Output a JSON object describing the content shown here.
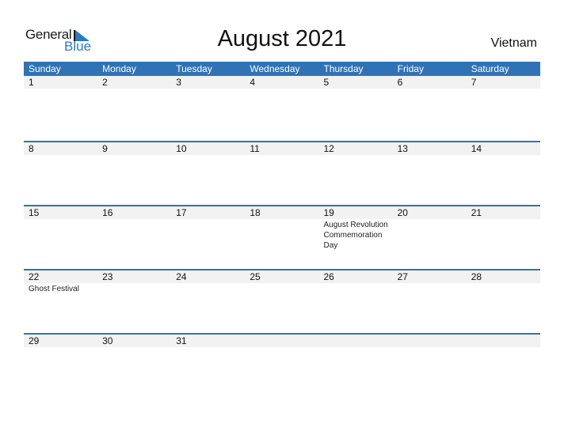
{
  "logo": {
    "general": "General",
    "blue": "Blue"
  },
  "title": "August 2021",
  "country": "Vietnam",
  "colors": {
    "header": "#2f73b5",
    "band": "#f2f2f2",
    "logo_blue": "#2a7ac4"
  },
  "weekdays": [
    "Sunday",
    "Monday",
    "Tuesday",
    "Wednesday",
    "Thursday",
    "Friday",
    "Saturday"
  ],
  "weeks": [
    {
      "days": [
        {
          "n": "1"
        },
        {
          "n": "2"
        },
        {
          "n": "3"
        },
        {
          "n": "4"
        },
        {
          "n": "5"
        },
        {
          "n": "6"
        },
        {
          "n": "7"
        }
      ]
    },
    {
      "days": [
        {
          "n": "8"
        },
        {
          "n": "9"
        },
        {
          "n": "10"
        },
        {
          "n": "11"
        },
        {
          "n": "12"
        },
        {
          "n": "13"
        },
        {
          "n": "14"
        }
      ]
    },
    {
      "days": [
        {
          "n": "15"
        },
        {
          "n": "16"
        },
        {
          "n": "17"
        },
        {
          "n": "18"
        },
        {
          "n": "19",
          "event": "August Revolution Commemoration Day"
        },
        {
          "n": "20"
        },
        {
          "n": "21"
        }
      ]
    },
    {
      "days": [
        {
          "n": "22",
          "event": "Ghost Festival"
        },
        {
          "n": "23"
        },
        {
          "n": "24"
        },
        {
          "n": "25"
        },
        {
          "n": "26"
        },
        {
          "n": "27"
        },
        {
          "n": "28"
        }
      ]
    },
    {
      "days": [
        {
          "n": "29"
        },
        {
          "n": "30"
        },
        {
          "n": "31"
        },
        {
          "n": ""
        },
        {
          "n": ""
        },
        {
          "n": ""
        },
        {
          "n": ""
        }
      ]
    }
  ]
}
